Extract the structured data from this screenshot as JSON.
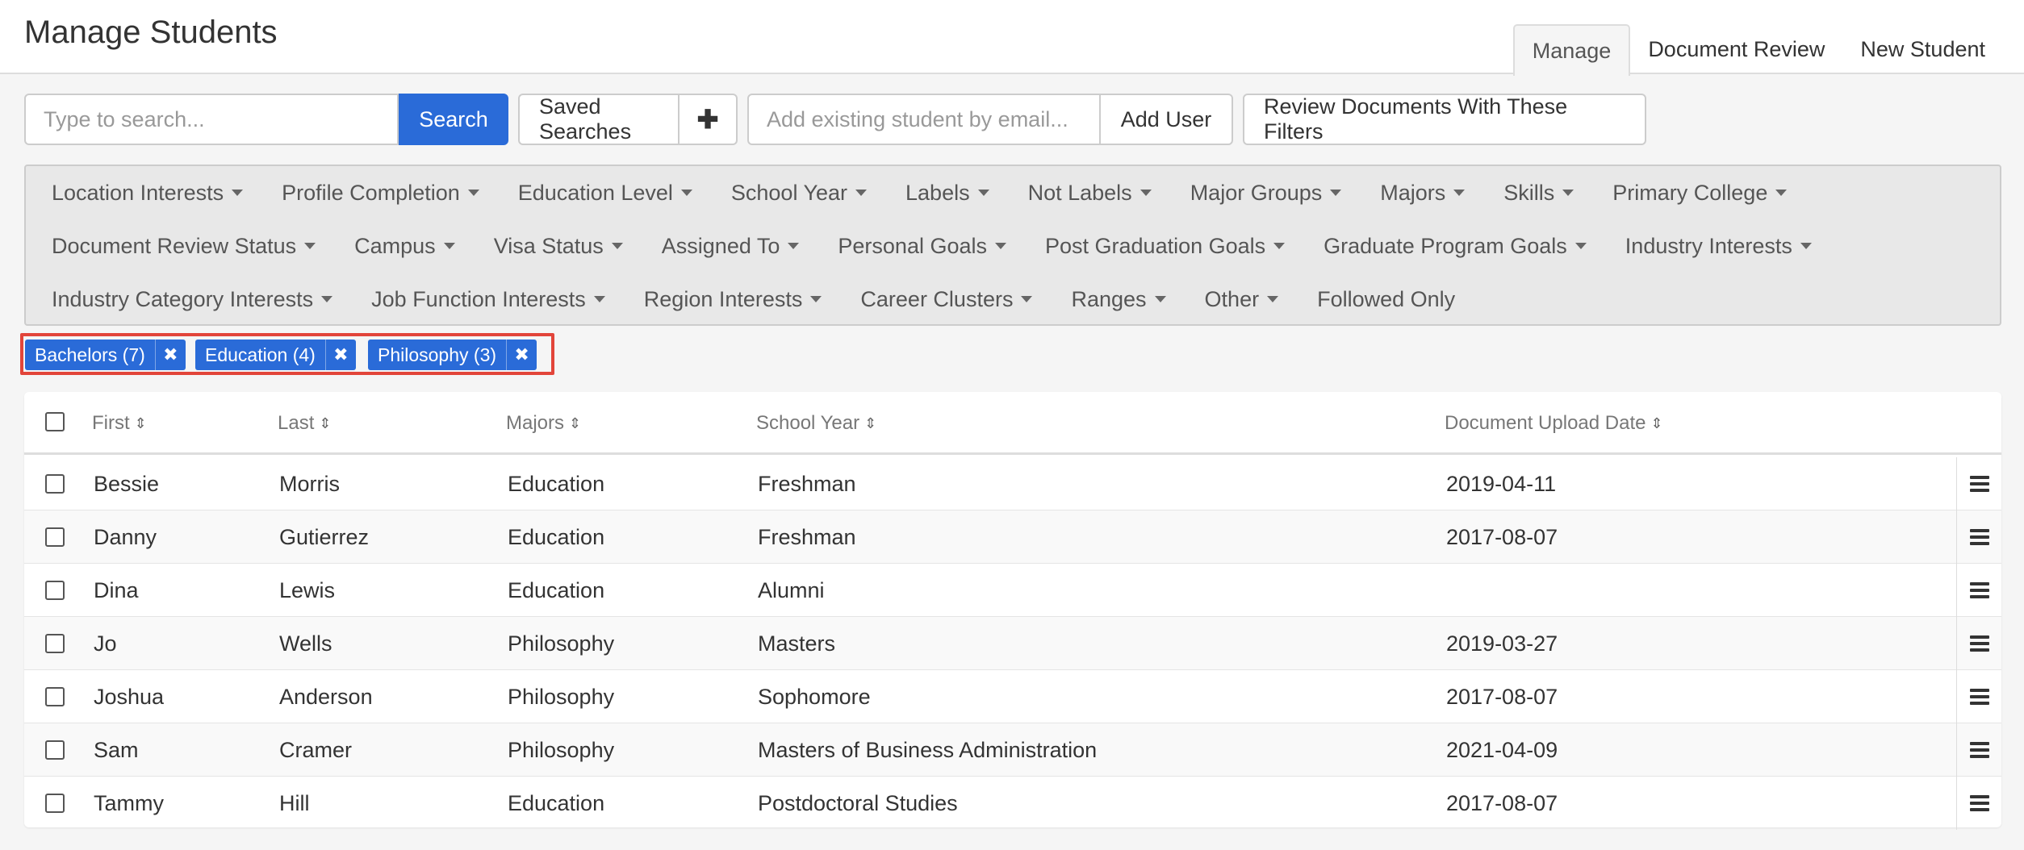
{
  "header": {
    "title": "Manage Students",
    "tabs": [
      {
        "label": "Manage",
        "active": true
      },
      {
        "label": "Document Review",
        "active": false
      },
      {
        "label": "New Student",
        "active": false
      }
    ]
  },
  "toolbar": {
    "search_placeholder": "Type to search...",
    "search_label": "Search",
    "saved_searches_label": "Saved Searches",
    "plus_label": "✚",
    "email_placeholder": "Add existing student by email...",
    "add_user_label": "Add User",
    "review_label": "Review Documents With These Filters"
  },
  "filters": {
    "row1": [
      "Location Interests",
      "Profile Completion",
      "Education Level",
      "School Year",
      "Labels",
      "Not Labels",
      "Major Groups",
      "Majors",
      "Skills",
      "Primary College"
    ],
    "row2": [
      "Document Review Status",
      "Campus",
      "Visa Status",
      "Assigned To",
      "Personal Goals",
      "Post Graduation Goals",
      "Graduate Program Goals",
      "Industry Interests"
    ],
    "row3": [
      "Industry Category Interests",
      "Job Function Interests",
      "Region Interests",
      "Career Clusters",
      "Ranges",
      "Other"
    ],
    "followed_only": "Followed Only"
  },
  "chips": [
    {
      "label": "Bachelors (7)",
      "remove": "✖"
    },
    {
      "label": "Education (4)",
      "remove": "✖"
    },
    {
      "label": "Philosophy (3)",
      "remove": "✖"
    }
  ],
  "table": {
    "columns": [
      "First",
      "Last",
      "Majors",
      "School Year",
      "Document Upload Date"
    ],
    "sort_glyph": "⇕",
    "rows": [
      [
        "Bessie",
        "Morris",
        "Education",
        "Freshman",
        "2019-04-11"
      ],
      [
        "Danny",
        "Gutierrez",
        "Education",
        "Freshman",
        "2017-08-07"
      ],
      [
        "Dina",
        "Lewis",
        "Education",
        "Alumni",
        ""
      ],
      [
        "Jo",
        "Wells",
        "Philosophy",
        "Masters",
        "2019-03-27"
      ],
      [
        "Joshua",
        "Anderson",
        "Philosophy",
        "Sophomore",
        "2017-08-07"
      ],
      [
        "Sam",
        "Cramer",
        "Philosophy",
        "Masters of Business Administration",
        "2021-04-09"
      ],
      [
        "Tammy",
        "Hill",
        "Education",
        "Postdoctoral Studies",
        "2017-08-07"
      ]
    ]
  },
  "colors": {
    "primary": "#2a6bd8",
    "highlight_border": "#e2453a"
  }
}
